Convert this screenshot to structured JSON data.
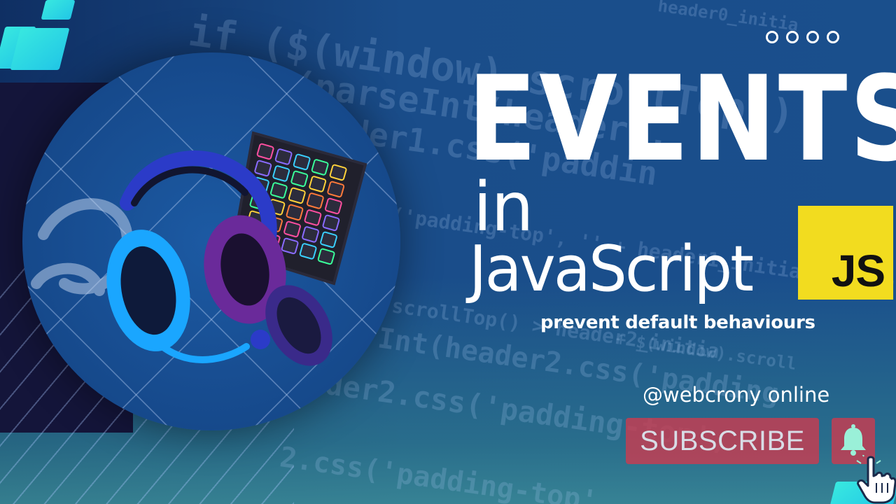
{
  "title": {
    "main": "EVENTS",
    "connector": "in",
    "language": "JavaScript",
    "badge": "JS"
  },
  "subtitle": "prevent default behaviours",
  "channel_handle": "@webcrony online",
  "subscribe_label": "SUBSCRIBE",
  "background_code": [
    "if ($(window).scrollTop()",
    "(parseInt(header1.",
    "der1.css('paddin",
    "('padding-top', '' + header1_initialPadding",
    "scrollTop() > header2_initia",
    "Int(header2.css('padding",
    "ader2.css('padding-top', '",
    "2.css('padding-top',",
    "header0_initia",
    "+ $(window).scroll"
  ],
  "icons": {
    "menu_dots": "circle-dots-icon",
    "bell": "bell-icon",
    "hand": "hand-cursor-icon",
    "headset": "gaming-headset-image",
    "keyboard": "gaming-keypad-image"
  },
  "colors": {
    "background": "#12366b",
    "js_badge": "#f2dc1f",
    "subscribe": "#c83c50",
    "accent_tiles": "#38e8e0"
  }
}
